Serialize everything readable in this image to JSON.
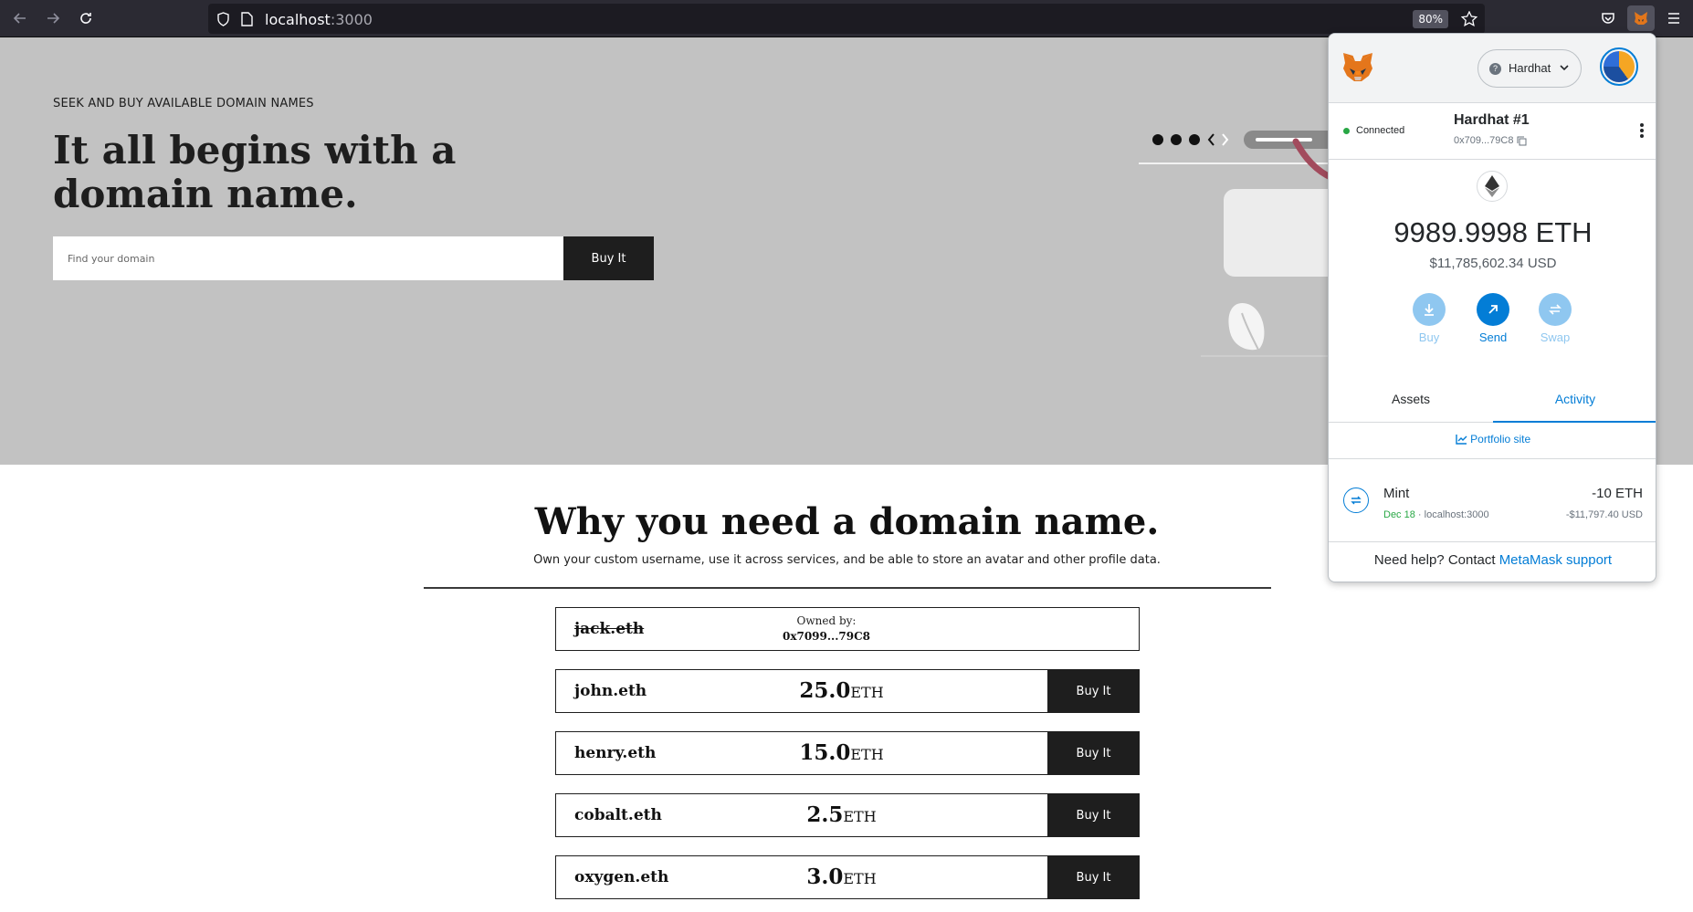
{
  "browser": {
    "url_host": "localhost",
    "url_port": ":3000",
    "zoom": "80%",
    "icons": [
      "back-icon",
      "forward-icon",
      "reload-icon",
      "shield-icon",
      "page-icon",
      "bookmark-star-icon",
      "pocket-icon",
      "metamask-fox-icon",
      "menu-icon"
    ]
  },
  "hero": {
    "kicker": "SEEK AND BUY AVAILABLE DOMAIN NAMES",
    "title": "It all begins with a domain name.",
    "search_placeholder": "Find your domain",
    "buy_label": "Buy It"
  },
  "why": {
    "title": "Why you need a domain name.",
    "subtitle": "Own your custom username, use it across services, and be able to store an avatar and other profile data."
  },
  "domains": [
    {
      "name": "jack.eth",
      "owned": true,
      "owned_label": "Owned by:",
      "owner": "0x7099...79C8"
    },
    {
      "name": "john.eth",
      "owned": false,
      "price": "25.0",
      "unit": "ETH",
      "buy_label": "Buy It"
    },
    {
      "name": "henry.eth",
      "owned": false,
      "price": "15.0",
      "unit": "ETH",
      "buy_label": "Buy It"
    },
    {
      "name": "cobalt.eth",
      "owned": false,
      "price": "2.5",
      "unit": "ETH",
      "buy_label": "Buy It"
    },
    {
      "name": "oxygen.eth",
      "owned": false,
      "price": "3.0",
      "unit": "ETH",
      "buy_label": "Buy It"
    }
  ],
  "metamask": {
    "network": "Hardhat",
    "status": "Connected",
    "account_name": "Hardhat #1",
    "account_address": "0x709...79C8",
    "balance": "9989.9998 ETH",
    "balance_usd": "$11,785,602.34 USD",
    "actions": {
      "buy": "Buy",
      "send": "Send",
      "swap": "Swap"
    },
    "tabs": {
      "assets": "Assets",
      "activity": "Activity"
    },
    "active_tab": "activity",
    "portfolio_link": "Portfolio site",
    "transaction": {
      "title": "Mint",
      "date": "Dec 18",
      "origin": "localhost:3000",
      "amount": "-10 ETH",
      "amount_usd": "-$11,797.40 USD"
    },
    "help_text": "Need help? Contact ",
    "help_link": "MetaMask support",
    "colors": {
      "primary": "#037dd6",
      "success": "#28a745",
      "muted_action": "#8fc7f0"
    }
  }
}
